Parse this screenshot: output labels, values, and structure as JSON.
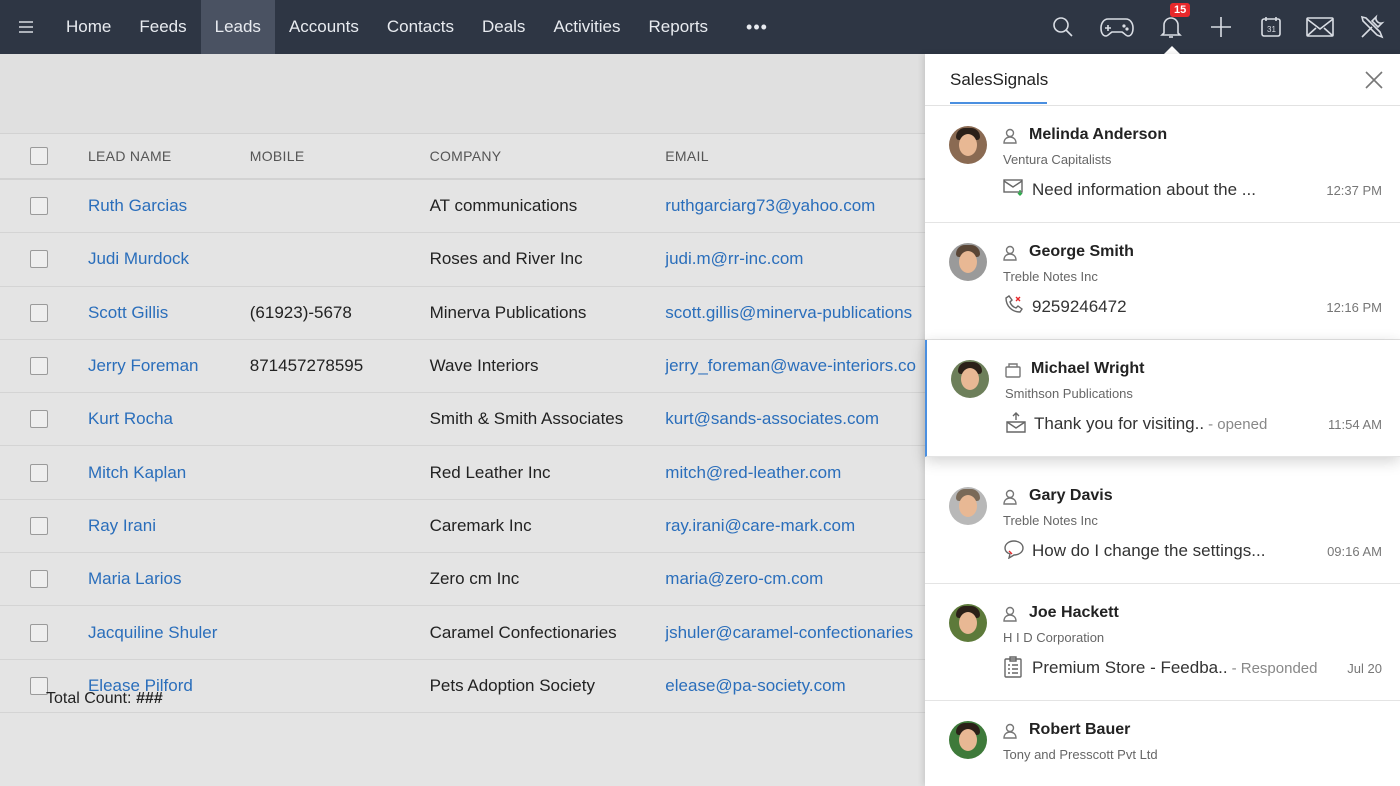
{
  "nav": {
    "items": [
      "Home",
      "Feeds",
      "Leads",
      "Accounts",
      "Contacts",
      "Deals",
      "Activities",
      "Reports"
    ],
    "active": "Leads",
    "more": "•••",
    "notification_count": "15"
  },
  "table": {
    "headers": {
      "name": "LEAD NAME",
      "mobile": "MOBILE",
      "company": "COMPANY",
      "email": "EMAIL"
    },
    "rows": [
      {
        "name": "Ruth Garcias",
        "mobile": "",
        "company": "AT communications",
        "email": "ruthgarciarg73@yahoo.com"
      },
      {
        "name": "Judi Murdock",
        "mobile": "",
        "company": "Roses and River Inc",
        "email": "judi.m@rr-inc.com"
      },
      {
        "name": "Scott Gillis",
        "mobile": "(61923)-5678",
        "company": "Minerva Publications",
        "email": "scott.gillis@minerva-publications"
      },
      {
        "name": "Jerry Foreman",
        "mobile": "871457278595",
        "company": "Wave Interiors",
        "email": "jerry_foreman@wave-interiors.co"
      },
      {
        "name": "Kurt Rocha",
        "mobile": "",
        "company": "Smith & Smith Associates",
        "email": "kurt@sands-associates.com"
      },
      {
        "name": "Mitch Kaplan",
        "mobile": "",
        "company": "Red Leather Inc",
        "email": "mitch@red-leather.com"
      },
      {
        "name": "Ray Irani",
        "mobile": "",
        "company": "Caremark Inc",
        "email": "ray.irani@care-mark.com"
      },
      {
        "name": "Maria Larios",
        "mobile": "",
        "company": "Zero cm Inc",
        "email": "maria@zero-cm.com"
      },
      {
        "name": "Jacquiline Shuler",
        "mobile": "",
        "company": "Caramel Confectionaries",
        "email": "jshuler@caramel-confectionaries"
      },
      {
        "name": "Elease Pilford",
        "mobile": "",
        "company": "Pets Adoption Society",
        "email": "elease@pa-society.com"
      }
    ],
    "total_label": "Total Count:",
    "total_value": "###"
  },
  "panel": {
    "title": "SalesSignals",
    "signals": [
      {
        "name": "Melinda Anderson",
        "company": "Ventura Capitalists",
        "icon": "mail-icon",
        "text": "Need information about the ...",
        "status": "",
        "time": "12:37 PM"
      },
      {
        "name": "George Smith",
        "company": "Treble Notes Inc",
        "icon": "missed-call-icon",
        "text": "9259246472",
        "status": "",
        "time": "12:16 PM"
      },
      {
        "name": "Michael Wright",
        "company": "Smithson Publications",
        "icon": "campaign-icon",
        "text": "Thank you for visiting..",
        "status": "- opened",
        "time": "11:54 AM"
      },
      {
        "name": "Gary Davis",
        "company": "Treble Notes Inc",
        "icon": "chat-icon",
        "text": "How do I change the settings...",
        "status": "",
        "time": "09:16 AM"
      },
      {
        "name": "Joe Hackett",
        "company": "H I D Corporation",
        "icon": "survey-icon",
        "text": "Premium Store - Feedba..",
        "status": "- Responded",
        "time": "Jul 20"
      },
      {
        "name": "Robert Bauer",
        "company": "Tony and Presscott Pvt Ltd",
        "icon": "",
        "text": "",
        "status": "",
        "time": ""
      }
    ]
  }
}
